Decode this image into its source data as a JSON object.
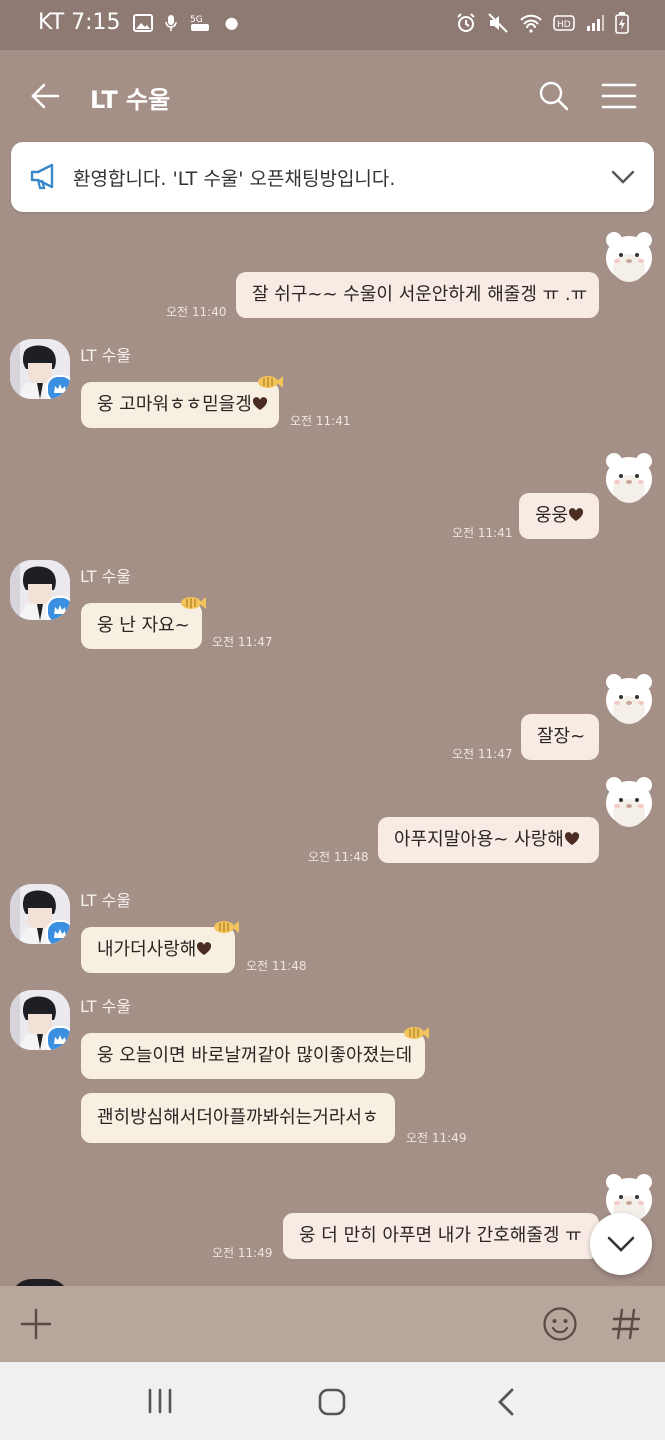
{
  "status": {
    "carrier_time": "KT 7:15"
  },
  "header": {
    "title": "LT 수울"
  },
  "notice": {
    "text": "환영합니다. 'LT 수울' 오픈채팅방입니다."
  },
  "messages": [
    {
      "side": "mine",
      "text": "잘 쉬구~~ 수울이 서운안하게 해줄겡 ㅠ .ㅠ",
      "time": "오전 11:40"
    },
    {
      "side": "theirs",
      "sender": "LT 수울",
      "text": "웅 고마워ㅎㅎ믿을겡",
      "heart": true,
      "time": "오전 11:41"
    },
    {
      "side": "mine",
      "text": "웅웅",
      "heart": true,
      "time": "오전 11:41"
    },
    {
      "side": "theirs",
      "sender": "LT 수울",
      "text": "웅 난 자요~",
      "time": "오전 11:47"
    },
    {
      "side": "mine",
      "text": "잘장~",
      "time": "오전 11:47"
    },
    {
      "side": "mine",
      "text": "아푸지말아용~ 사랑해",
      "heart": true,
      "time": "오전 11:48"
    },
    {
      "side": "theirs",
      "sender": "LT 수울",
      "text": "내가더사랑해",
      "heart": true,
      "time": "오전 11:48"
    },
    {
      "side": "theirs",
      "sender": "LT 수울",
      "text": "웅 오늘이면 바로날꺼같아 많이좋아졌는데",
      "time": ""
    },
    {
      "side": "theirs",
      "text": "괜히방심해서더아플까봐쉬는거라서ㅎ",
      "time": "오전 11:49"
    },
    {
      "side": "mine",
      "text": "웅 더 만히 아푸면 내가 간호해줄겡 ㅠ",
      "time": "오전 11:49"
    }
  ],
  "colors": {
    "background": "#a59088",
    "my_bubble": "#f7ebe4",
    "their_bubble": "#f7efe2",
    "badge": "#3b8fe0"
  }
}
